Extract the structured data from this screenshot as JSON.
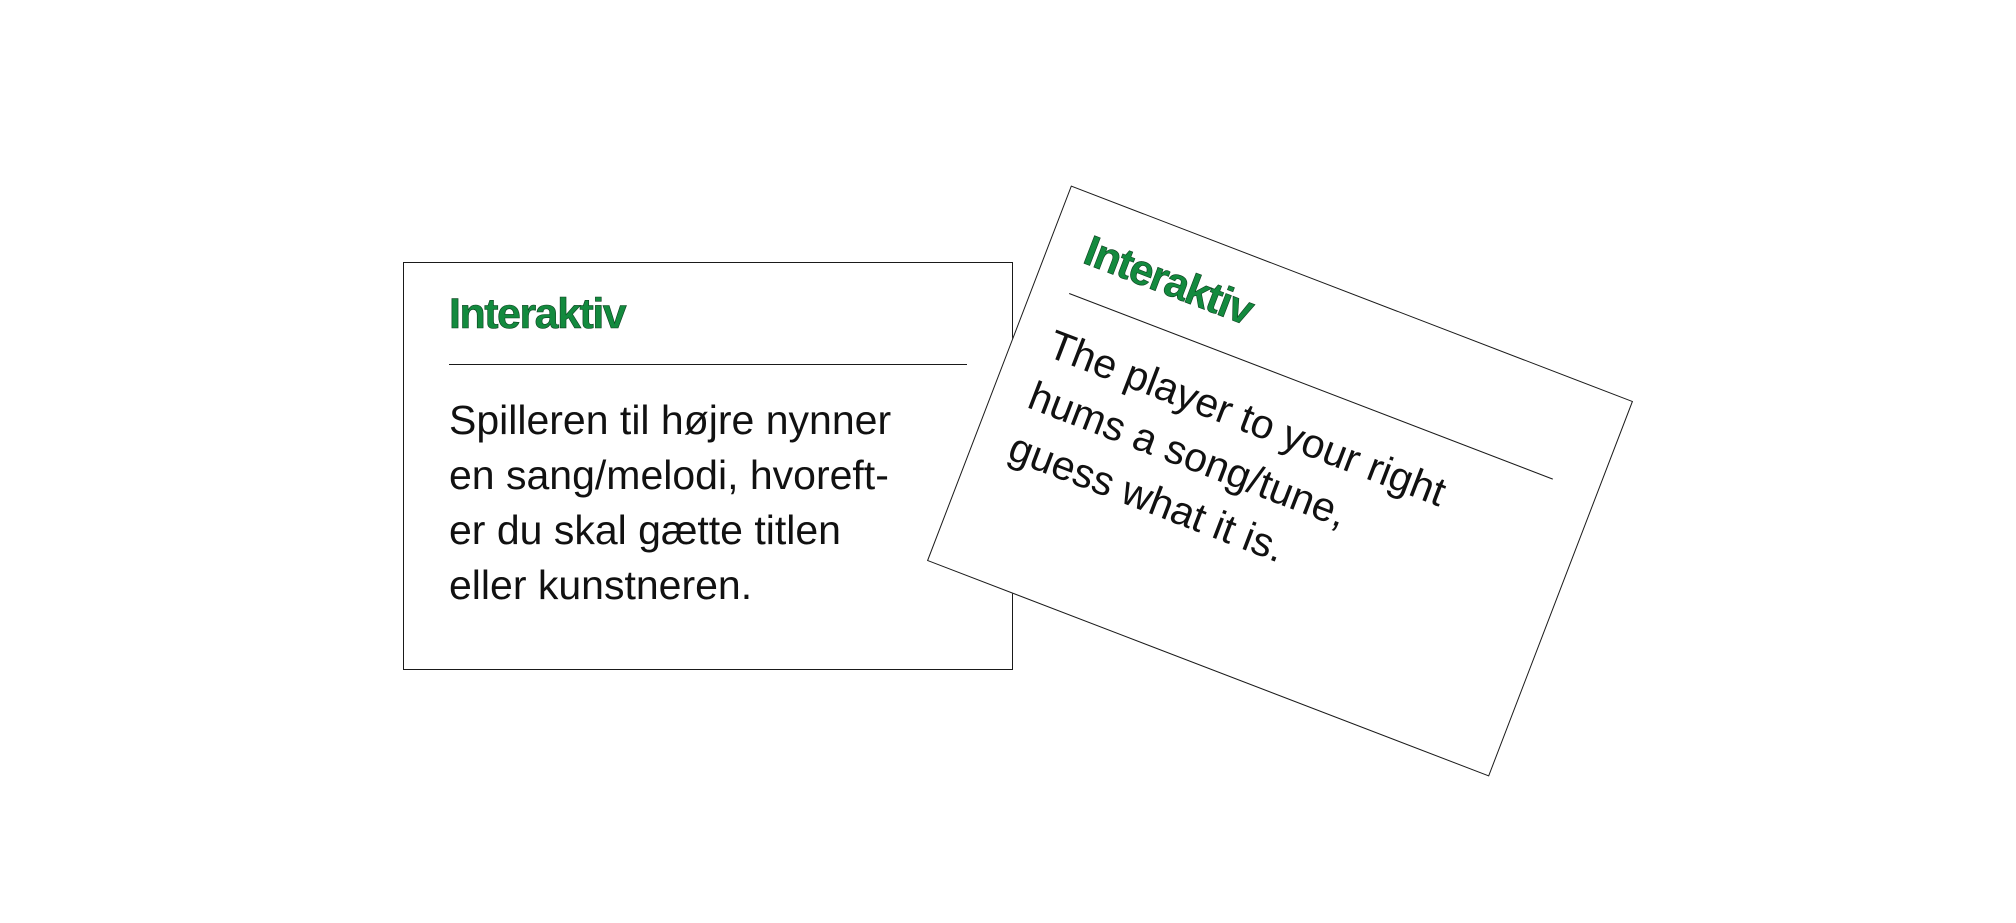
{
  "cards": [
    {
      "title": "Interaktiv",
      "body": "Spilleren til højre nynner\nen sang/melodi, hvoreft-\ner du skal gætte titlen\neller kunstneren."
    },
    {
      "title": "Interaktiv",
      "body": "The player to your right\nhums a song/tune,\nguess what it is."
    }
  ],
  "colors": {
    "title_green": "#138a3e",
    "text": "#111111",
    "border": "#1a1a1a",
    "background": "#ffffff"
  }
}
